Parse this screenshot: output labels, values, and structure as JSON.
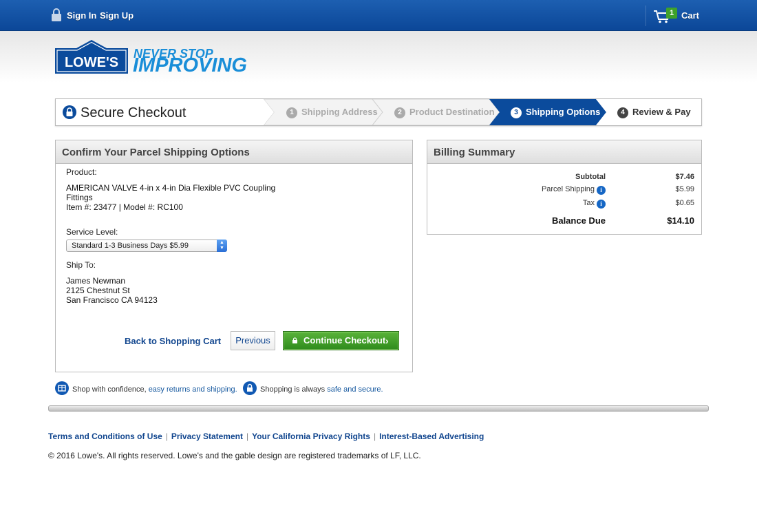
{
  "topbar": {
    "sign_in": "Sign In",
    "sign_up": "Sign Up",
    "cart_count": "1",
    "cart_label": "Cart"
  },
  "brand": {
    "logo_text": "LOWE'S",
    "slogan_line1": "NEVER STOP",
    "slogan_line2": "IMPROVING"
  },
  "progress": {
    "title": "Secure Checkout",
    "steps": [
      {
        "num": "1",
        "label": "Shipping Address",
        "state": "done"
      },
      {
        "num": "2",
        "label": "Product Destination",
        "state": "done"
      },
      {
        "num": "3",
        "label": "Shipping Options",
        "state": "active"
      },
      {
        "num": "4",
        "label": "Review & Pay",
        "state": "upcoming"
      }
    ]
  },
  "shipping_panel": {
    "title": "Confirm Your Parcel Shipping Options",
    "product_label": "Product:",
    "product_name_line1": "AMERICAN VALVE 4-in x 4-in Dia Flexible PVC Coupling",
    "product_name_line2": "Fittings",
    "product_ids": "Item #: 23477 | Model #: RC100",
    "service_label": "Service Level:",
    "service_value": "Standard 1-3 Business Days $5.99",
    "ship_to_label": "Ship To:",
    "address_line1": "James  Newman",
    "address_line2": "2125 Chestnut St",
    "address_line3": "San Francisco  CA 94123",
    "back_link": "Back to Shopping Cart",
    "previous_button": "Previous",
    "continue_button": "Continue Checkout"
  },
  "billing": {
    "title": "Billing Summary",
    "subtotal_label": "Subtotal",
    "subtotal_value": "$7.46",
    "parcel_label": "Parcel Shipping",
    "parcel_value": "$5.99",
    "tax_label": "Tax",
    "tax_value": "$0.65",
    "balance_label": "Balance Due",
    "balance_value": "$14.10"
  },
  "confidence": {
    "text1": "Shop with confidence, ",
    "link1": "easy returns and shipping.",
    "text2": "Shopping is always ",
    "link2": "safe and secure."
  },
  "footer": {
    "links": [
      "Terms and Conditions of Use",
      "Privacy Statement",
      "Your California Privacy Rights",
      "Interest-Based Advertising"
    ],
    "copyright": "© 2016 Lowe's. All rights reserved. Lowe's and the gable design are registered trademarks of LF, LLC."
  },
  "colors": {
    "brand_blue": "#0b4b9c",
    "accent_light_blue": "#1a8ed8",
    "continue_green": "#3ea12b"
  }
}
